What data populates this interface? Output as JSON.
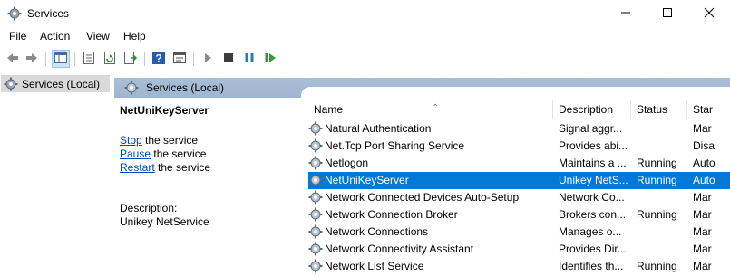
{
  "window": {
    "title": "Services",
    "icon": "gear-icon",
    "controls": [
      "minimize-icon",
      "maximize-icon",
      "close-icon"
    ]
  },
  "menu": [
    "File",
    "Action",
    "View",
    "Help"
  ],
  "toolbar": [
    "back-icon",
    "forward-icon",
    "show-hide-tree-icon",
    "properties-icon",
    "refresh-icon",
    "export-list-icon",
    "help-icon",
    "console-icon",
    "start-icon",
    "stop-icon",
    "pause-icon",
    "restart-icon"
  ],
  "tree": {
    "item": "Services (Local)"
  },
  "content": {
    "header": "Services (Local)",
    "selected_service": "NetUniKeyServer",
    "actions": [
      {
        "link": "Stop",
        "rest": " the service"
      },
      {
        "link": "Pause",
        "rest": " the service"
      },
      {
        "link": "Restart",
        "rest": " the service"
      }
    ],
    "description_label": "Description:",
    "description_text": "Unikey NetService"
  },
  "list": {
    "columns": [
      "Name",
      "Description",
      "Status",
      "Star"
    ],
    "rows": [
      {
        "name": "Natural Authentication",
        "description": "Signal aggr...",
        "status": "",
        "startup": "Mar"
      },
      {
        "name": "Net.Tcp Port Sharing Service",
        "description": "Provides abi...",
        "status": "",
        "startup": "Disa"
      },
      {
        "name": "Netlogon",
        "description": "Maintains a ...",
        "status": "Running",
        "startup": "Auto"
      },
      {
        "name": "NetUniKeyServer",
        "description": "Unikey NetS...",
        "status": "Running",
        "startup": "Auto",
        "selected": true
      },
      {
        "name": "Network Connected Devices Auto-Setup",
        "description": "Network Co...",
        "status": "",
        "startup": "Mar"
      },
      {
        "name": "Network Connection Broker",
        "description": "Brokers con...",
        "status": "Running",
        "startup": "Mar"
      },
      {
        "name": "Network Connections",
        "description": "Manages o...",
        "status": "",
        "startup": "Mar"
      },
      {
        "name": "Network Connectivity Assistant",
        "description": "Provides Dir...",
        "status": "",
        "startup": "Mar"
      },
      {
        "name": "Network List Service",
        "description": "Identifies th...",
        "status": "Running",
        "startup": "Mar"
      }
    ]
  },
  "colors": {
    "selection": "#0078d7",
    "header_band": "#a9bfd6",
    "link": "#0645ad"
  }
}
